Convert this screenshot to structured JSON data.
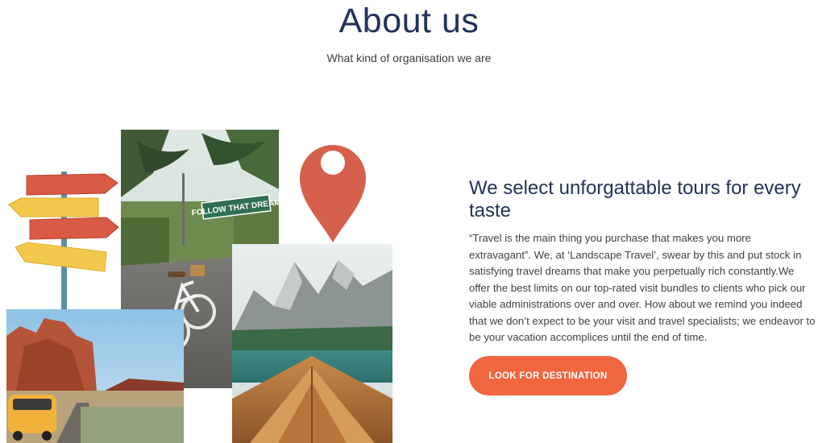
{
  "page": {
    "title": "About us",
    "subtitle": "What kind of organisation we are"
  },
  "collage": {
    "street_sign_text": "FOLLOW THAT DREAM",
    "images": [
      "signpost-illustration",
      "bicycle-palm-street-photo",
      "map-pin-icon",
      "lake-boat-photo",
      "desert-van-photo"
    ]
  },
  "content": {
    "headline": "We select unforgattable tours for every taste",
    "body": "“Travel is the main thing you purchase that makes you more extravagant”. We, at ‘Landscape Travel’, swear by this and put stock in satisfying travel dreams that make you perpetually rich constantly.We offer the best limits on our top-rated visit bundles to clients who pick our viable administrations over and over. How about we remind you indeed that we don’t expect to be your visit and travel specialists; we endeavor to be your vacation accomplices until the end of time.",
    "cta_label": "LOOK FOR DESTINATION"
  },
  "colors": {
    "heading": "#22325a",
    "accent": "#f0663f",
    "pin": "#d6604b",
    "sign_red": "#d95a45",
    "sign_yellow": "#f2c94c"
  }
}
